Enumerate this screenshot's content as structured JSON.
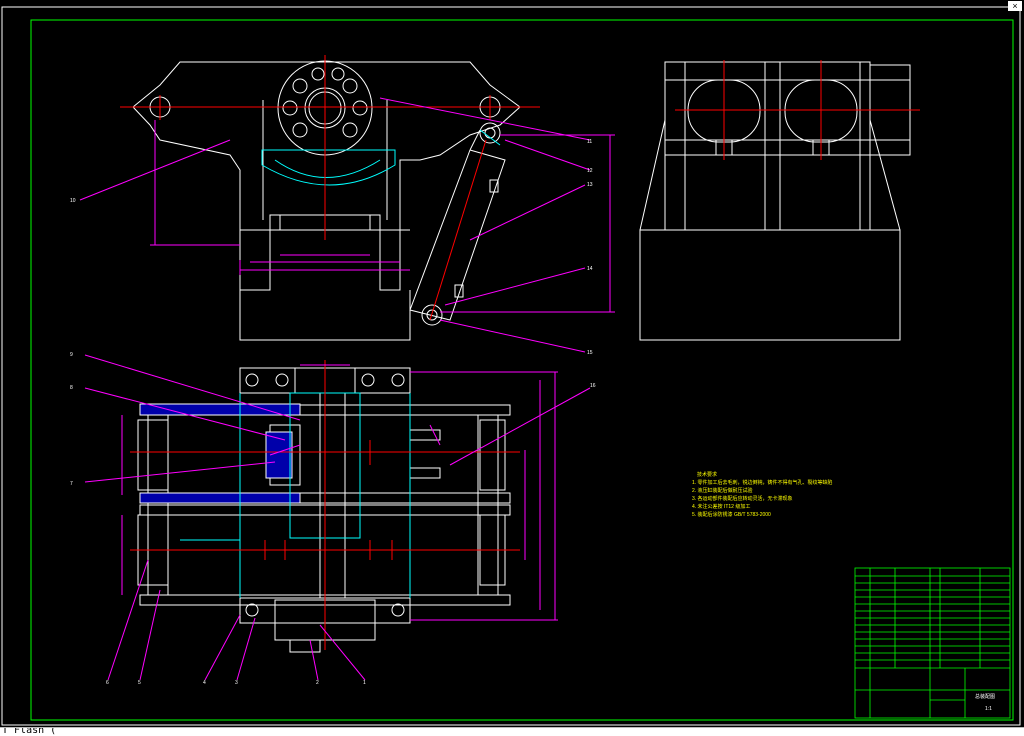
{
  "window": {
    "close_glyph": "×"
  },
  "command_line": {
    "text": "T  Flash ("
  },
  "balloons": [
    "1",
    "2",
    "3",
    "4",
    "5",
    "6",
    "7",
    "8",
    "9",
    "10",
    "11",
    "12",
    "13",
    "14",
    "15",
    "16"
  ],
  "tech_requirements": {
    "title": "技术要求",
    "items": [
      "1. 零件加工后去毛刺，锐边倒钝，铸件不得有气孔、裂纹等缺陷",
      "2. 液压缸装配后做耐压试验",
      "3. 各运动部件装配后应转动灵活，无卡滞现象",
      "4. 未注公差按 IT12 级加工",
      "5. 装配后涂防锈漆 GB/T 5783-2000"
    ]
  },
  "title_block": {
    "drawing_title": "总装配图",
    "scale": "1:1"
  },
  "colors": {
    "background": "#000000",
    "outline": "#ffffff",
    "dimension": "#ff00ff",
    "centerline": "#ff0000",
    "hidden": "#00ffff",
    "highlight": "#0000aa",
    "frame": "#00ff00",
    "note": "#ffff00"
  }
}
